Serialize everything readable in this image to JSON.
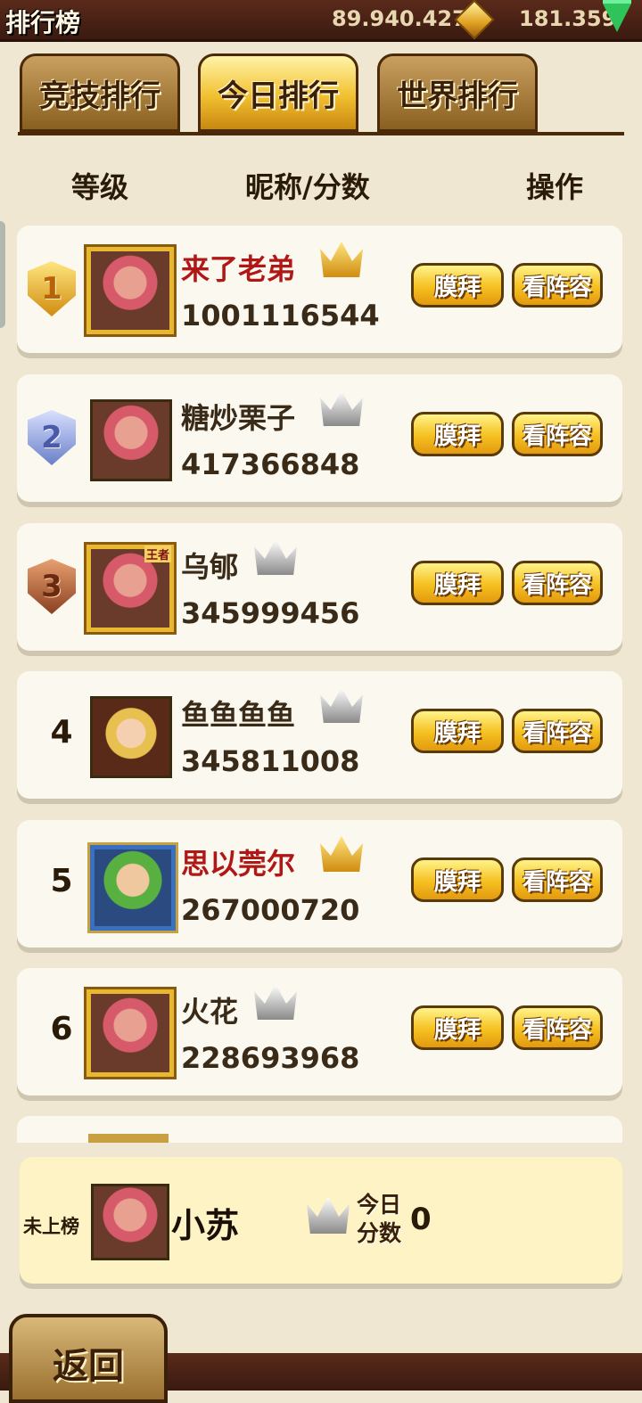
{
  "topbar": {
    "title": "排行榜",
    "gold": "89.940.427",
    "gems": "181.359"
  },
  "tabs": [
    {
      "label": "竞技排行",
      "active": false
    },
    {
      "label": "今日排行",
      "active": true
    },
    {
      "label": "世界排行",
      "active": false
    }
  ],
  "header": {
    "level": "等级",
    "name_score": "昵称/分数",
    "action": "操作"
  },
  "rows": [
    {
      "rank": "1",
      "name": "来了老弟",
      "score": "1001116544",
      "crown": "gold"
    },
    {
      "rank": "2",
      "name": "糖炒栗子",
      "score": "417366848",
      "crown": "silver"
    },
    {
      "rank": "3",
      "name": "乌郇",
      "score": "345999456",
      "crown": "silver"
    },
    {
      "rank": "4",
      "name": "鱼鱼鱼鱼",
      "score": "345811008",
      "crown": "silver"
    },
    {
      "rank": "5",
      "name": "思以莞尔",
      "score": "267000720",
      "crown": "gold"
    },
    {
      "rank": "6",
      "name": "火花",
      "score": "228693968",
      "crown": "silver"
    }
  ],
  "buttons": {
    "worship": "膜拜",
    "lineup": "看阵容"
  },
  "rank3_frame_label": "王者",
  "self": {
    "label": "未上榜",
    "name": "小苏",
    "today_line1": "今日",
    "today_line2": "分数",
    "score": "0"
  },
  "footer": {
    "back": "返回"
  },
  "colors": {
    "accent": "#f5c020",
    "red_name": "#b01818",
    "panel": "#fbf8ef"
  }
}
